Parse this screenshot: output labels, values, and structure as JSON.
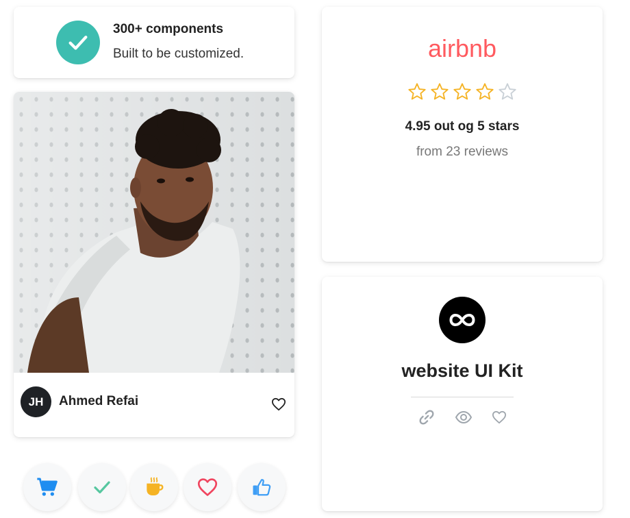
{
  "feature_card": {
    "title": "300+ components",
    "subtitle": "Built to be customized."
  },
  "profile_card": {
    "avatar_initials": "JH",
    "name": "Ahmed Refai"
  },
  "action_buttons": [
    {
      "icon": "cart-icon",
      "color": "#1f8df0"
    },
    {
      "icon": "check-icon",
      "color": "#57c7a0"
    },
    {
      "icon": "coffee-icon",
      "color": "#f5b324"
    },
    {
      "icon": "heart-icon",
      "color": "#f0455f"
    },
    {
      "icon": "thumbs-up-icon",
      "color": "#3f9ef5"
    }
  ],
  "rating_card": {
    "brand": "airbnb",
    "brand_color": "#ff5a5f",
    "stars_filled": 4,
    "stars_total": 5,
    "rating_text": "4.95 out og 5 stars",
    "reviews_text": "from 23 reviews"
  },
  "kit_card": {
    "icon": "infinity-icon",
    "title": "website UI Kit",
    "actions": [
      "link-icon",
      "eye-icon",
      "heart-outline-icon"
    ]
  }
}
